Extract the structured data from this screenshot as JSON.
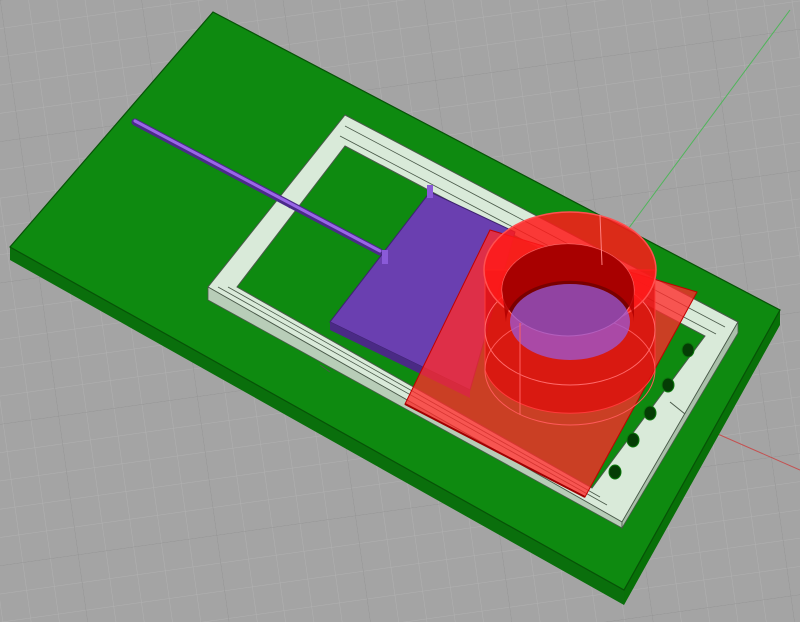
{
  "viewport": {
    "type": "perspective-3d-view",
    "colors": {
      "background": "#a4a4a4",
      "grid_minor": "#b2b2b2",
      "grid_major": "#8e8e8e",
      "axis_x": "#c45050",
      "axis_y": "#4fb55a",
      "base_plate": "#0e8a10",
      "base_plate_edge": "#0a5a0b",
      "frame": "#d9ead9",
      "frame_edge": "#4a5a4a",
      "plunger": "#6a3fb0",
      "rod": "#8a55d8",
      "cylinder": "#ff1a1a",
      "mount_plate": "#ff2020"
    },
    "objects": [
      {
        "name": "base-plate",
        "icon": "green-box"
      },
      {
        "name": "rail-frame",
        "icon": "light-green-frame"
      },
      {
        "name": "push-rod",
        "icon": "purple-rod"
      },
      {
        "name": "plunger-block",
        "icon": "purple-block"
      },
      {
        "name": "cylinder-tube",
        "icon": "red-cylinder"
      },
      {
        "name": "cylinder-mount-plate",
        "icon": "red-plate"
      },
      {
        "name": "mounting-holes",
        "count": 5
      }
    ]
  }
}
